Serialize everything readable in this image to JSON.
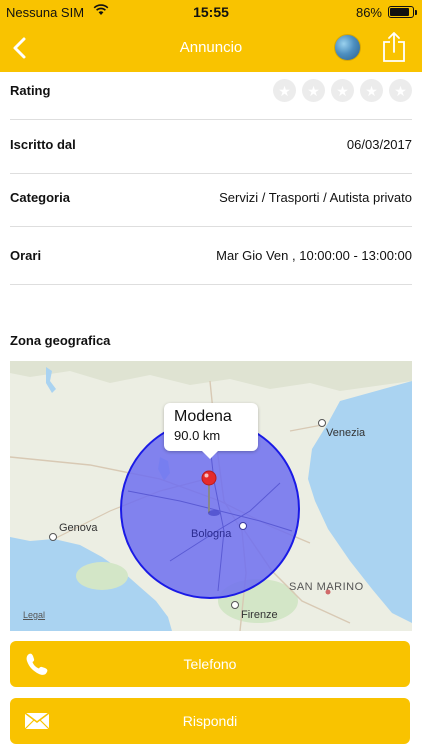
{
  "status_bar": {
    "carrier": "Nessuna SIM",
    "time": "15:55",
    "battery": "86%",
    "battery_level": 0.86
  },
  "nav": {
    "title": "Annuncio",
    "back_icon": "chevron-left-icon",
    "avatar_icon": "globe-avatar-icon",
    "share_icon": "share-icon"
  },
  "details": {
    "rating": {
      "label": "Rating",
      "stars_filled": 0,
      "stars_total": 5
    },
    "iscritto": {
      "label": "Iscritto dal",
      "value": "06/03/2017"
    },
    "categoria": {
      "label": "Categoria",
      "value": "Servizi / Trasporti / Autista privato"
    },
    "orari": {
      "label": "Orari",
      "value": "Mar Gio Ven , 10:00:00 - 13:00:00"
    }
  },
  "map": {
    "section_label": "Zona geografica",
    "callout_title": "Modena",
    "callout_subtitle": "90.0 km",
    "cities": {
      "venezia": "Venezia",
      "genova": "Genova",
      "bologna": "Bologna",
      "san_marino": "SAN MARINO",
      "firenze": "Firenze"
    },
    "legal": "Legal"
  },
  "actions": {
    "telefono": "Telefono",
    "rispondi": "Rispondi"
  },
  "colors": {
    "accent": "#f9c300",
    "radius_fill": "#6f6ff0",
    "radius_stroke": "#1a1ae6",
    "pin": "#e52b2b"
  }
}
